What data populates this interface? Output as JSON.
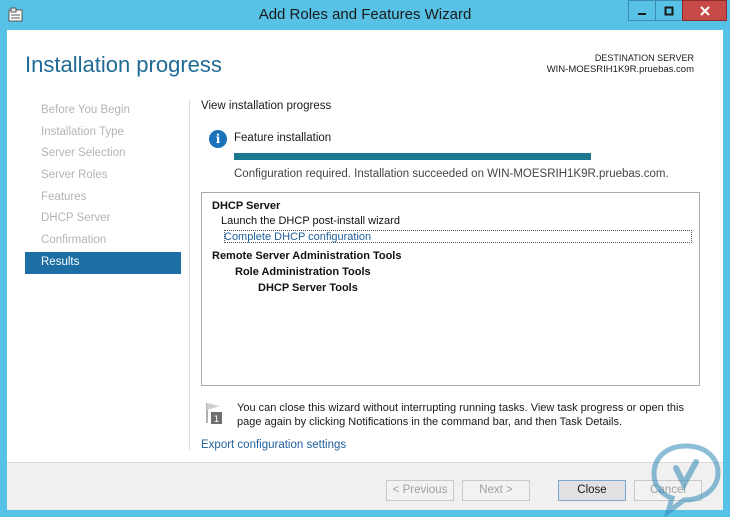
{
  "window": {
    "title": "Add Roles and Features Wizard"
  },
  "header": {
    "page_title": "Installation progress",
    "destination_label": "DESTINATION SERVER",
    "destination_server": "WIN-MOESRIH1K9R.pruebas.com"
  },
  "nav": {
    "items": [
      {
        "label": "Before You Begin",
        "active": false
      },
      {
        "label": "Installation Type",
        "active": false
      },
      {
        "label": "Server Selection",
        "active": false
      },
      {
        "label": "Server Roles",
        "active": false
      },
      {
        "label": "Features",
        "active": false
      },
      {
        "label": "DHCP Server",
        "active": false
      },
      {
        "label": "Confirmation",
        "active": false
      },
      {
        "label": "Results",
        "active": true
      }
    ]
  },
  "main": {
    "heading": "View installation progress",
    "feature_install": "Feature installation",
    "progress_percent": 100,
    "status_message": "Configuration required. Installation succeeded on WIN-MOESRIH1K9R.pruebas.com.",
    "results": {
      "dhcp_server": "DHCP Server",
      "launch_wizard": "Launch the DHCP post-install wizard",
      "complete_link": "Complete DHCP configuration",
      "rsat": "Remote Server Administration Tools",
      "role_admin_tools": "Role Administration Tools",
      "dhcp_tools": "DHCP Server Tools"
    },
    "note": "You can close this wizard without interrupting running tasks. View task progress or open this page again by clicking Notifications in the command bar, and then Task Details.",
    "export_link": "Export configuration settings"
  },
  "footer": {
    "previous": "< Previous",
    "next": "Next >",
    "close": "Close",
    "cancel": "Cancel"
  },
  "colors": {
    "titlebar": "#57c1e6",
    "accent_title": "#1f6b96",
    "nav_active": "#1c6ea4",
    "progress": "#1b788f",
    "close_button": "#c74a47"
  }
}
